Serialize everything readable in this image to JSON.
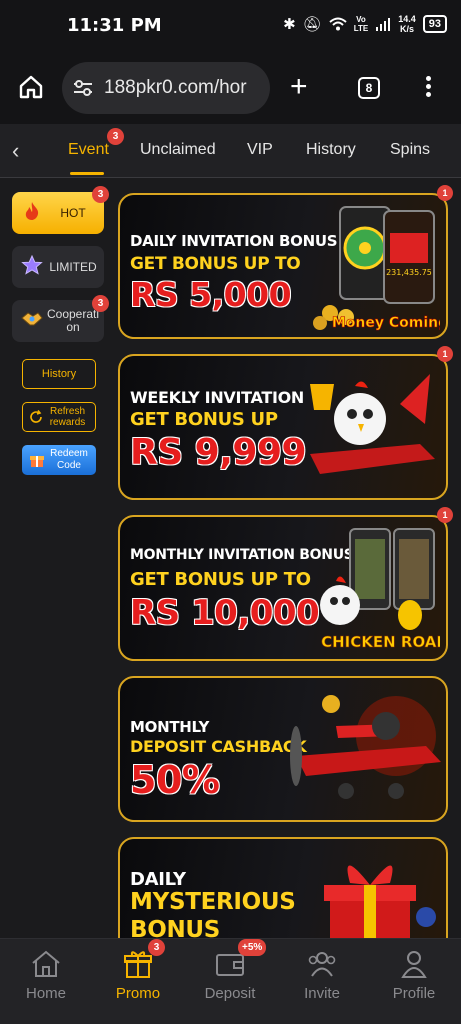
{
  "status": {
    "time": "11:31 PM",
    "net_speed_top": "14.4",
    "net_speed_bottom": "K/s",
    "lte_top": "Vo",
    "lte_bottom": "LTE",
    "battery": "93"
  },
  "browser": {
    "url": "188pkr0.com/hor",
    "tab_count": "8"
  },
  "tabs": [
    {
      "label": "Event",
      "badge": "3",
      "active": true
    },
    {
      "label": "Unclaimed"
    },
    {
      "label": "VIP"
    },
    {
      "label": "History"
    },
    {
      "label": "Spins"
    }
  ],
  "sidebar": {
    "cards": [
      {
        "label": "HOT",
        "badge": "3",
        "icon": "flame-icon"
      },
      {
        "label": "LIMITED",
        "icon": "star-icon"
      },
      {
        "label": "Cooperati on",
        "badge": "3",
        "icon": "handshake-icon"
      }
    ],
    "history_label": "History",
    "refresh_label": "Refresh rewards",
    "redeem_label": "Redeem Code"
  },
  "banners": [
    {
      "line1": "DAILY INVITATION BONUS",
      "line2": "GET BONUS UP TO",
      "line3": "RS 5,000",
      "badge": "1",
      "art_text": "Money Coming",
      "art_value": "231,435.75"
    },
    {
      "line1": "WEEKLY INVITATION",
      "line2": "GET BONUS UP",
      "line3": "RS 9,999",
      "badge": "1"
    },
    {
      "line1": "MONTHLY INVITATION BONUS",
      "line2": "GET BONUS UP TO",
      "line3": "RS 10,000",
      "badge": "1",
      "art_text": "CHICKEN ROAD"
    },
    {
      "line1": "MONTHLY",
      "line2": "DEPOSIT CASHBACK",
      "line3": "50%"
    },
    {
      "line1": "DAILY",
      "line2": "MYSTERIOUS",
      "line3": "BONUS"
    }
  ],
  "bottom_nav": [
    {
      "label": "Home"
    },
    {
      "label": "Promo",
      "badge": "3",
      "active": true
    },
    {
      "label": "Deposit",
      "badge": "+5%"
    },
    {
      "label": "Invite"
    },
    {
      "label": "Profile"
    }
  ],
  "colors": {
    "accent": "#f6b400",
    "badge": "#e0423a",
    "bg": "#1b1b1d",
    "banner_border": "#d9a520"
  }
}
